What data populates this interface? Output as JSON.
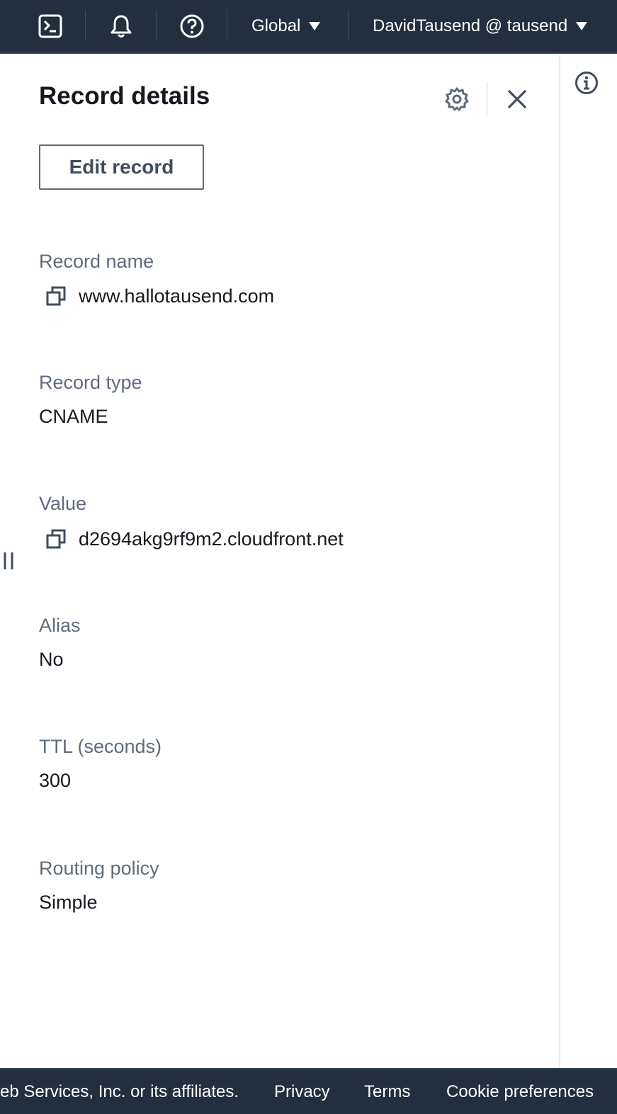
{
  "topbar": {
    "cloudshell_icon": "terminal-icon",
    "notifications_icon": "bell-icon",
    "help_icon": "question-circle-icon",
    "region": "Global",
    "account": "DavidTausend @ tausend"
  },
  "panel": {
    "title": "Record details",
    "edit_button": "Edit record",
    "fields": [
      {
        "label": "Record name",
        "value": "www.hallotausend.com",
        "copyable": true
      },
      {
        "label": "Record type",
        "value": "CNAME",
        "copyable": false
      },
      {
        "label": "Value",
        "value": "d2694akg9rf9m2.cloudfront.net",
        "copyable": true
      },
      {
        "label": "Alias",
        "value": "No",
        "copyable": false
      },
      {
        "label": "TTL (seconds)",
        "value": "300",
        "copyable": false
      },
      {
        "label": "Routing policy",
        "value": "Simple",
        "copyable": false
      }
    ]
  },
  "footer": {
    "copyright": "eb Services, Inc. or its affiliates.",
    "privacy": "Privacy",
    "terms": "Terms",
    "cookies": "Cookie preferences"
  },
  "colors": {
    "topbar_bg": "#232f3e",
    "label_text": "#5f6b7a",
    "body_text": "#16191f"
  }
}
